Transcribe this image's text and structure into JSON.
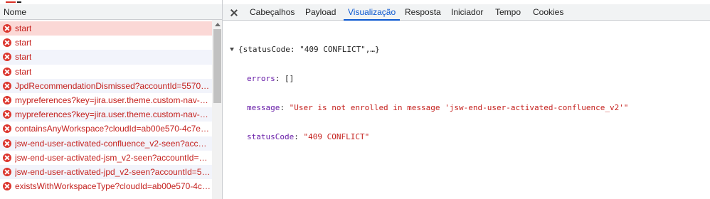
{
  "network": {
    "column_header": "Nome",
    "requests": [
      {
        "label": "start"
      },
      {
        "label": "start"
      },
      {
        "label": "start"
      },
      {
        "label": "start"
      },
      {
        "label": "JpdRecommendationDismissed?accountId=557058..."
      },
      {
        "label": "mypreferences?key=jira.user.theme.custom-nav-bar..."
      },
      {
        "label": "mypreferences?key=jira.user.theme.custom-nav-bar..."
      },
      {
        "label": "containsAnyWorkspace?cloudId=ab00e570-4c7e-4a..."
      },
      {
        "label": "jsw-end-user-activated-confluence_v2-seen?accoun..."
      },
      {
        "label": "jsw-end-user-activated-jsm_v2-seen?accountId=557..."
      },
      {
        "label": "jsw-end-user-activated-jpd_v2-seen?accountId=557..."
      },
      {
        "label": "existsWithWorkspaceType?cloudId=ab00e570-4c7e-..."
      }
    ]
  },
  "detail": {
    "tabs": [
      {
        "label": "Cabeçalhos"
      },
      {
        "label": "Payload"
      },
      {
        "label": "Visualização"
      },
      {
        "label": "Resposta"
      },
      {
        "label": "Iniciador"
      },
      {
        "label": "Tempo"
      },
      {
        "label": "Cookies"
      }
    ],
    "active_tab": "Visualização",
    "preview": {
      "summary": "{statusCode: \"409 CONFLICT\",…}",
      "lines": [
        {
          "key": "errors",
          "sep": ": ",
          "value": "[]",
          "type": "plain"
        },
        {
          "key": "message",
          "sep": ": ",
          "value": "\"User is not enrolled in message 'jsw-end-user-activated-confluence_v2'\"",
          "type": "string"
        },
        {
          "key": "statusCode",
          "sep": ": ",
          "value": "\"409 CONFLICT\"",
          "type": "string"
        }
      ]
    }
  },
  "colors": {
    "error": "#dc362e",
    "accent": "#0b57d0",
    "selected_row": "#fbd8d6"
  }
}
